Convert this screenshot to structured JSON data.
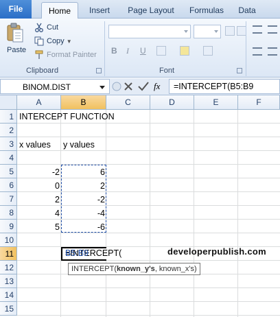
{
  "ribbon": {
    "tabs": [
      "File",
      "Home",
      "Insert",
      "Page Layout",
      "Formulas",
      "Data"
    ],
    "clipboard": {
      "paste_label": "Paste",
      "cut_label": "Cut",
      "copy_label": "Copy",
      "format_painter_label": "Format Painter",
      "group_label": "Clipboard"
    },
    "font": {
      "bold": "B",
      "italic": "I",
      "underline": "U",
      "group_label": "Font"
    }
  },
  "formula_bar": {
    "name_box": "BINOM.DIST",
    "fx": "fx",
    "formula": "=INTERCEPT(B5:B9"
  },
  "grid": {
    "columns": [
      "A",
      "B",
      "C",
      "D",
      "E",
      "F"
    ],
    "rows": [
      "1",
      "2",
      "3",
      "4",
      "5",
      "6",
      "7",
      "8",
      "9",
      "10",
      "11",
      "12",
      "13",
      "14",
      "15"
    ],
    "selected_column": "B",
    "selected_row": "11",
    "a1": "INTERCEPT FUNCTION",
    "a3": "x values",
    "b3": "y values",
    "x_values": [
      "-2",
      "0",
      "2",
      "4",
      "5"
    ],
    "y_values": [
      "6",
      "2",
      "-2",
      "-4",
      "-6"
    ],
    "edit_prefix": "=INTERCEPT(",
    "edit_range": "B5:B9",
    "tooltip_fn": "INTERCEPT(",
    "tooltip_arg1": "known_y's",
    "tooltip_rest": ", known_x's)"
  },
  "watermark": "developerpublish.com",
  "colors": {
    "file_tab": "#2a6ec7",
    "selection_header": "#f1c15f",
    "marquee": "#1f4ea8",
    "range_ref": "#1f4ea8"
  }
}
